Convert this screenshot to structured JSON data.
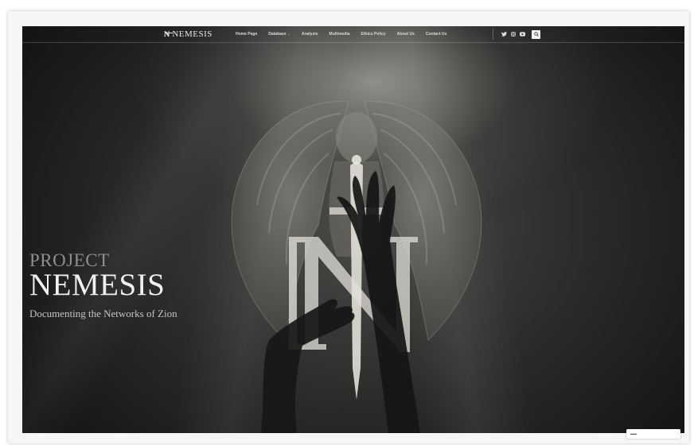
{
  "header": {
    "logo_mark": "ɴ̶",
    "logo_text": "NEMESIS",
    "nav": [
      {
        "label": "Home Page"
      },
      {
        "label": "Database",
        "has_dropdown": true
      },
      {
        "label": "Analysis"
      },
      {
        "label": "Multimedia"
      },
      {
        "label": "Ethics Policy"
      },
      {
        "label": "About Us"
      },
      {
        "label": "Contact Us"
      }
    ],
    "social_icons": [
      "twitter-icon",
      "instagram-icon",
      "youtube-icon"
    ],
    "search_icon": "search-icon"
  },
  "hero": {
    "kicker": "PROJECT",
    "title": "NEMESIS",
    "subtitle": "Documenting the Networks of Zion"
  },
  "colors": {
    "hero_dark": "#1a1a1a",
    "title_light": "#f1f1f1",
    "kicker_gray": "#8f8f8f"
  }
}
